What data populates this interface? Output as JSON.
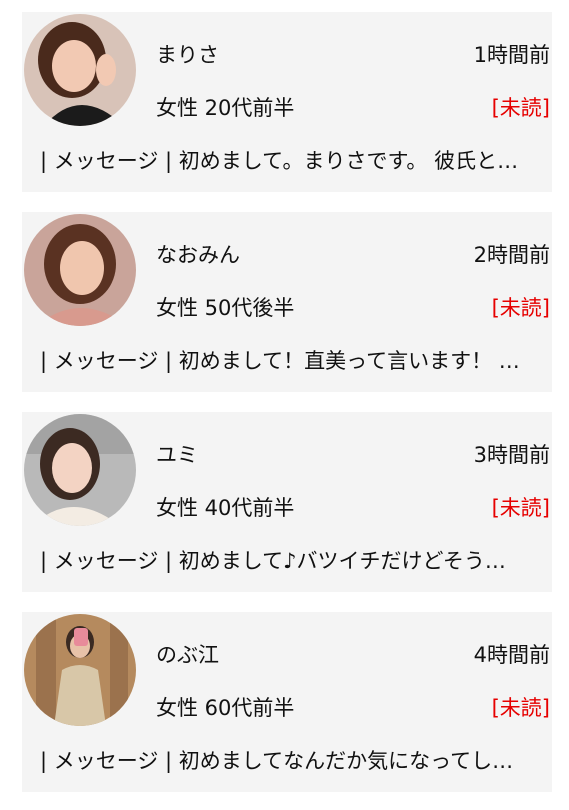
{
  "messages": [
    {
      "name": "まりさ",
      "time": "1時間前",
      "profile": "女性 20代前半",
      "status": "[未読]",
      "preview": "| メッセージ | 初めまして。まりさです。 彼氏と…",
      "avatar_icon": "user-photo-avatar",
      "colors": {
        "bg": "#d8c3b8",
        "hair": "#4a2a1c",
        "skin": "#f2c9b3",
        "cloth": "#1b1b1b"
      }
    },
    {
      "name": "なおみん",
      "time": "2時間前",
      "profile": "女性 50代後半",
      "status": "[未読]",
      "preview": "| メッセージ | 初めまして！直美って言います！ …",
      "avatar_icon": "user-photo-avatar",
      "colors": {
        "bg": "#c9a49a",
        "hair": "#5a3222",
        "skin": "#f0c6ae",
        "cloth": "#d89a8e"
      }
    },
    {
      "name": "ユミ",
      "time": "3時間前",
      "profile": "女性 40代前半",
      "status": "[未読]",
      "preview": "| メッセージ | 初めまして♪バツイチだけどそう…",
      "avatar_icon": "user-photo-avatar",
      "colors": {
        "bg": "#b9b9b9",
        "hair": "#3c2a22",
        "skin": "#f3d3c3",
        "cloth": "#f3ece3"
      }
    },
    {
      "name": "のぶ江",
      "time": "4時間前",
      "profile": "女性 60代前半",
      "status": "[未読]",
      "preview": "| メッセージ | 初めましてなんだか気になってし…",
      "avatar_icon": "user-photo-avatar",
      "colors": {
        "bg": "#b58a5e",
        "hair": "#3a2a22",
        "skin": "#e8c2a8",
        "cloth": "#d8c7a8"
      }
    }
  ],
  "theme": {
    "card_bg": "#f4f4f4",
    "unread_color": "#e60000",
    "text_color": "#111111"
  }
}
